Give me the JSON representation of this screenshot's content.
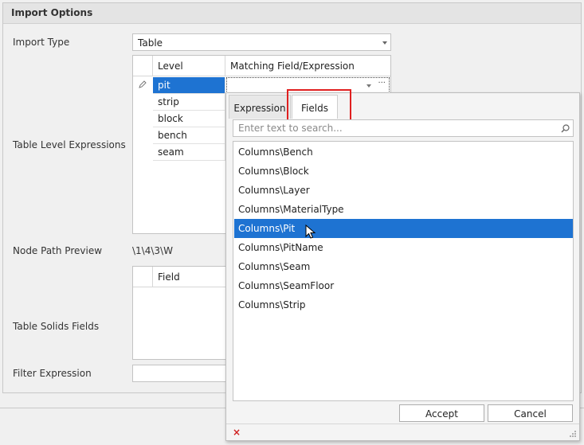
{
  "header": {
    "title": "Import Options"
  },
  "form": {
    "import_type_label": "Import Type",
    "import_type_value": "Table",
    "table_level_label": "Table Level Expressions",
    "node_path_label": "Node Path Preview",
    "node_path_value": "\\1\\4\\3\\W",
    "table_solids_label": "Table Solids Fields",
    "filter_label": "Filter Expression"
  },
  "level_grid": {
    "columns": [
      "Level",
      "Matching Field/Expression"
    ],
    "rows": [
      "pit",
      "strip",
      "block",
      "bench",
      "seam"
    ],
    "selected_row": "pit",
    "ellipsis": "···"
  },
  "solids_grid": {
    "columns": [
      "Field"
    ]
  },
  "popup": {
    "tabs": [
      "Expression",
      "Fields"
    ],
    "active_tab": "Fields",
    "search_placeholder": "Enter text to search...",
    "items": [
      "Columns\\Bench",
      "Columns\\Block",
      "Columns\\Layer",
      "Columns\\MaterialType",
      "Columns\\Pit",
      "Columns\\PitName",
      "Columns\\Seam",
      "Columns\\SeamFloor",
      "Columns\\Strip"
    ],
    "selected_item": "Columns\\Pit",
    "accept_label": "Accept",
    "cancel_label": "Cancel",
    "close_glyph": "×"
  },
  "colors": {
    "selection": "#1e73d2",
    "highlight_box": "#e02020",
    "close_x": "#d02020"
  }
}
